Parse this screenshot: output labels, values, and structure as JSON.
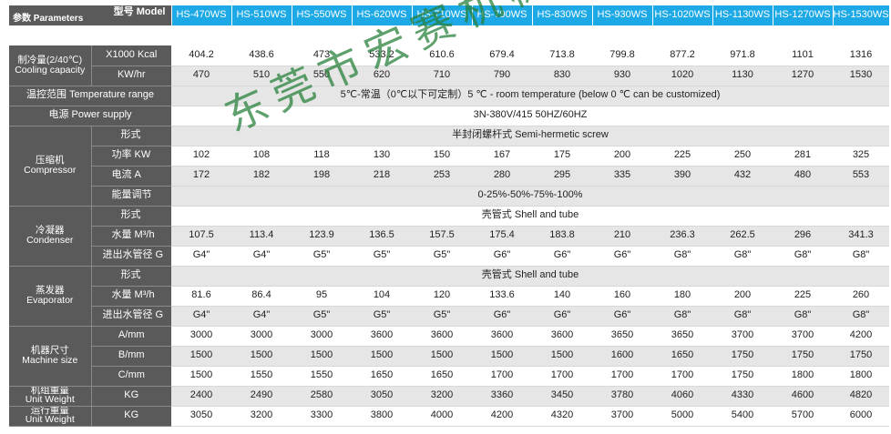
{
  "header": {
    "model_label": "型号 Model",
    "params_label": "参数 Parameters",
    "models": [
      "HS-470WS",
      "HS-510WS",
      "HS-550WS",
      "HS-620WS",
      "HS-710WS",
      "HS-790WS",
      "HS-830WS",
      "HS-930WS",
      "HS-1020WS",
      "HS-1130WS",
      "HS-1270WS",
      "HS-1530WS"
    ]
  },
  "cooling": {
    "label_cn": "制冷量(2/40℃)",
    "label_en": "Cooling capacity",
    "rows": [
      {
        "unit": "X1000 Kcal",
        "values": [
          "404.2",
          "438.6",
          "473",
          "533.2",
          "610.6",
          "679.4",
          "713.8",
          "799.8",
          "877.2",
          "971.8",
          "1101",
          "1316"
        ]
      },
      {
        "unit": "KW/hr",
        "values": [
          "470",
          "510",
          "550",
          "620",
          "710",
          "790",
          "830",
          "930",
          "1020",
          "1130",
          "1270",
          "1530"
        ]
      }
    ]
  },
  "temp_range": {
    "label": "温控范围 Temperature range",
    "value": "5℃-常温（0℃以下可定制）5 ℃ - room temperature (below 0 ℃ can be customized)"
  },
  "power": {
    "label": "电源 Power supply",
    "value": "3N-380V/415    50HZ/60HZ"
  },
  "compressor": {
    "label_cn": "压缩机",
    "label_en": "Compressor",
    "type_label": "形式",
    "type_value": "半封闭螺杆式 Semi-hermetic screw",
    "power_label": "功率 KW",
    "power_values": [
      "102",
      "108",
      "118",
      "130",
      "150",
      "167",
      "175",
      "200",
      "225",
      "250",
      "281",
      "325"
    ],
    "current_label": "电流 A",
    "current_values": [
      "172",
      "182",
      "198",
      "218",
      "253",
      "280",
      "295",
      "335",
      "390",
      "432",
      "480",
      "553"
    ],
    "capacity_label": "能量调节",
    "capacity_value": "0-25%-50%-75%-100%"
  },
  "condenser": {
    "label_cn": "冷凝器",
    "label_en": "Condenser",
    "type_label": "形式",
    "type_value": "壳管式 Shell and tube",
    "water_label": "水量 M³/h",
    "water_values": [
      "107.5",
      "113.4",
      "123.9",
      "136.5",
      "157.5",
      "175.4",
      "183.8",
      "210",
      "236.3",
      "262.5",
      "296",
      "341.3"
    ],
    "pipe_label": "进出水管径 G",
    "pipe_values": [
      "G4\"",
      "G4\"",
      "G5\"",
      "G5\"",
      "G5\"",
      "G6\"",
      "G6\"",
      "G6\"",
      "G8\"",
      "G8\"",
      "G8\"",
      "G8\""
    ]
  },
  "evaporator": {
    "label_cn": "蒸发器",
    "label_en": "Evaporator",
    "type_label": "形式",
    "type_value": "壳管式 Shell and tube",
    "water_label": "水量 M³/h",
    "water_values": [
      "81.6",
      "86.4",
      "95",
      "104",
      "120",
      "133.6",
      "140",
      "160",
      "180",
      "200",
      "225",
      "260"
    ],
    "pipe_label": "进出水管径 G",
    "pipe_values": [
      "G4\"",
      "G4\"",
      "G5\"",
      "G5\"",
      "G5\"",
      "G6\"",
      "G6\"",
      "G6\"",
      "G8\"",
      "G8\"",
      "G8\"",
      "G8\""
    ]
  },
  "size": {
    "label_cn": "机器尺寸",
    "label_en": "Machine size",
    "rows": [
      {
        "unit": "A/mm",
        "values": [
          "3000",
          "3000",
          "3000",
          "3600",
          "3600",
          "3600",
          "3600",
          "3650",
          "3650",
          "3700",
          "3700",
          "4200"
        ]
      },
      {
        "unit": "B/mm",
        "values": [
          "1500",
          "1500",
          "1500",
          "1500",
          "1500",
          "1500",
          "1500",
          "1600",
          "1650",
          "1750",
          "1750",
          "1750"
        ]
      },
      {
        "unit": "C/mm",
        "values": [
          "1500",
          "1550",
          "1550",
          "1650",
          "1650",
          "1700",
          "1700",
          "1700",
          "1700",
          "1750",
          "1800",
          "1800"
        ]
      }
    ]
  },
  "unit_weight": {
    "label_cn": "机组重量",
    "label_en": "Unit Weight",
    "unit": "KG",
    "values": [
      "2400",
      "2490",
      "2580",
      "3050",
      "3200",
      "3360",
      "3450",
      "3780",
      "4060",
      "4330",
      "4600",
      "4820"
    ]
  },
  "run_weight": {
    "label_cn": "运行重量",
    "label_en": "Unit Weight",
    "unit": "KG",
    "values": [
      "3050",
      "3200",
      "3300",
      "3800",
      "4000",
      "4200",
      "4320",
      "3700",
      "5000",
      "5400",
      "5700",
      "6000"
    ]
  },
  "watermark": "东莞市宏赛机械有限公司"
}
